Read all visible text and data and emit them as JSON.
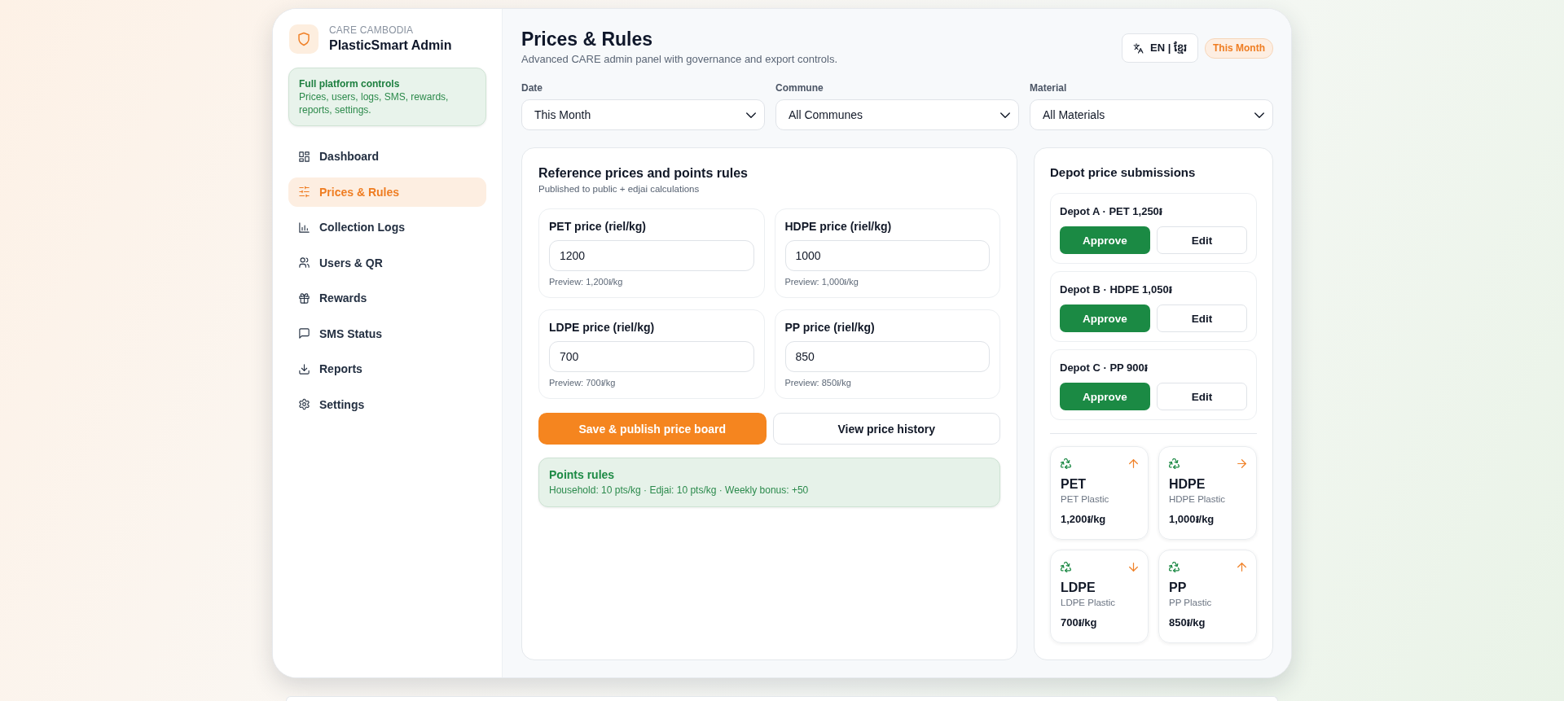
{
  "brand": {
    "org": "CARE CAMBODIA",
    "app": "PlasticSmart Admin"
  },
  "notice": {
    "title": "Full platform controls",
    "text": "Prices, users, logs, SMS, rewards, reports, settings."
  },
  "sidebar": {
    "items": [
      {
        "label": "Dashboard",
        "selected": false
      },
      {
        "label": "Prices & Rules",
        "selected": true
      },
      {
        "label": "Collection Logs",
        "selected": false
      },
      {
        "label": "Users & QR",
        "selected": false
      },
      {
        "label": "Rewards",
        "selected": false
      },
      {
        "label": "SMS Status",
        "selected": false
      },
      {
        "label": "Reports",
        "selected": false
      },
      {
        "label": "Settings",
        "selected": false
      }
    ]
  },
  "header": {
    "title": "Prices & Rules",
    "subtitle": "Advanced CARE admin panel with governance and export controls.",
    "language_button": "EN | ខ្មែរ",
    "period_badge": "This Month"
  },
  "filters": [
    {
      "label": "Date",
      "value": "This Month"
    },
    {
      "label": "Commune",
      "value": "All Communes"
    },
    {
      "label": "Material",
      "value": "All Materials"
    }
  ],
  "reference_card": {
    "title": "Reference prices and points rules",
    "subtitle": "Published to public + edjai calculations",
    "prices": [
      {
        "label": "PET price (riel/kg)",
        "value": "1200",
        "preview": "Preview: 1,200៛/kg"
      },
      {
        "label": "HDPE price (riel/kg)",
        "value": "1000",
        "preview": "Preview: 1,000៛/kg"
      },
      {
        "label": "LDPE price (riel/kg)",
        "value": "700",
        "preview": "Preview: 700៛/kg"
      },
      {
        "label": "PP price (riel/kg)",
        "value": "850",
        "preview": "Preview: 850៛/kg"
      }
    ],
    "buttons": [
      {
        "label": "Save & publish price board",
        "kind": "primary"
      },
      {
        "label": "View price history",
        "kind": "secondary"
      }
    ],
    "points_rules": {
      "title": "Points rules",
      "text": "Household: 10 pts/kg · Edjai: 10 pts/kg · Weekly bonus: +50"
    }
  },
  "depot_card": {
    "title": "Depot price submissions",
    "submissions": [
      {
        "label": "Depot A · PET 1,250៛",
        "approve": "Approve",
        "edit": "Edit"
      },
      {
        "label": "Depot B · HDPE 1,050៛",
        "approve": "Approve",
        "edit": "Edit"
      },
      {
        "label": "Depot C · PP 900៛",
        "approve": "Approve",
        "edit": "Edit"
      }
    ],
    "materials": [
      {
        "code": "PET",
        "name": "PET Plastic",
        "price": "1,200៛/kg",
        "kind": "up"
      },
      {
        "code": "HDPE",
        "name": "HDPE Plastic",
        "price": "1,000៛/kg",
        "kind": "flat"
      },
      {
        "code": "LDPE",
        "name": "LDPE Plastic",
        "price": "700៛/kg",
        "kind": "down"
      },
      {
        "code": "PP",
        "name": "PP Plastic",
        "price": "850៛/kg",
        "kind": "up"
      }
    ]
  }
}
